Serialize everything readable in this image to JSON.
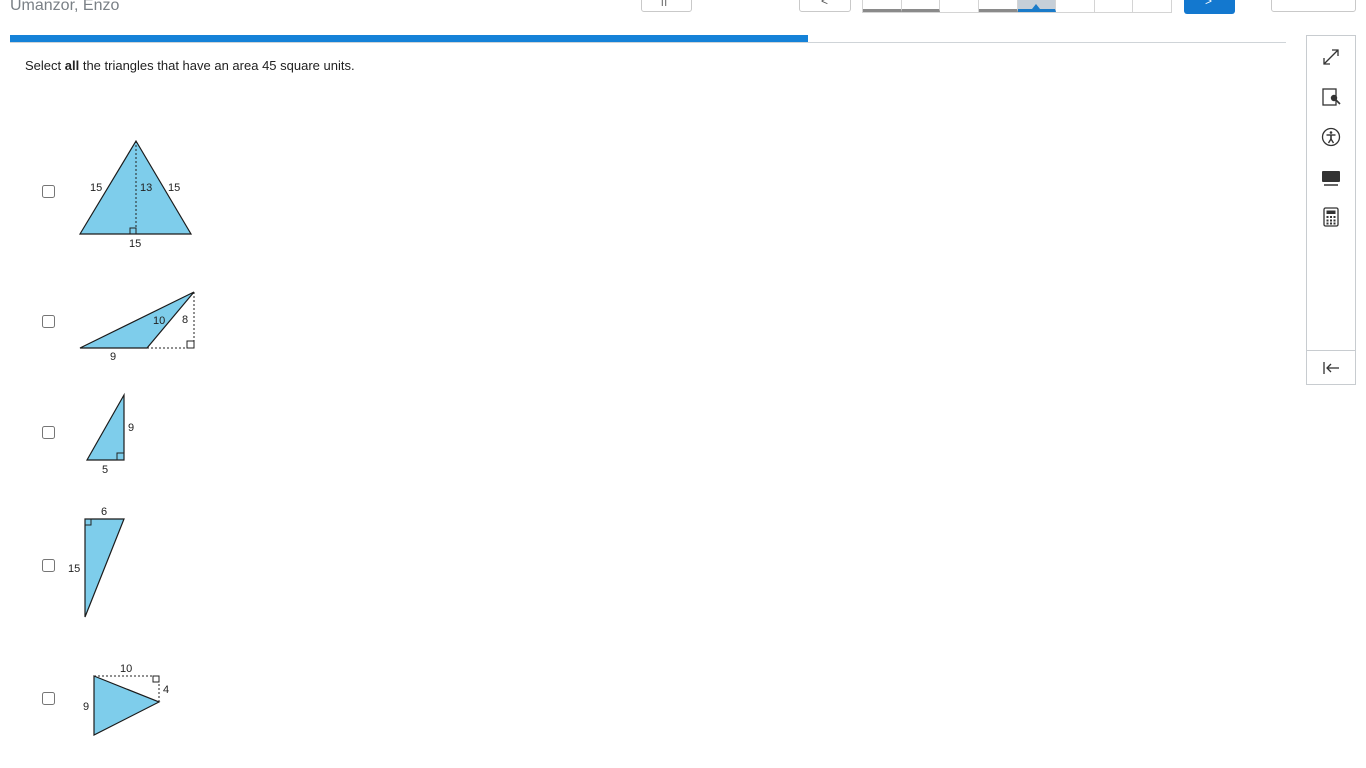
{
  "header": {
    "student_name": "Umanzor, Enzo",
    "pause_label": "II",
    "back_label": "<",
    "next_label": ">",
    "review_label": "",
    "nav_cells": [
      "answered",
      "answered",
      "empty",
      "answered",
      "current",
      "empty",
      "empty",
      "empty"
    ],
    "accent_color": "#1378cf"
  },
  "progress": {
    "fraction": 0.625
  },
  "question": {
    "prefix": "Select ",
    "emphasis": "all",
    "suffix": " the triangles that have an area 45 square units."
  },
  "options": [
    {
      "id": "a",
      "labels": [
        "15",
        "13",
        "15",
        "15"
      ]
    },
    {
      "id": "b",
      "labels": [
        "10",
        "8",
        "9"
      ]
    },
    {
      "id": "c",
      "labels": [
        "9",
        "5"
      ]
    },
    {
      "id": "d",
      "labels": [
        "6",
        "15"
      ]
    },
    {
      "id": "e",
      "labels": [
        "10",
        "4",
        "9"
      ]
    }
  ],
  "toolbar": {
    "icons": [
      "expand-icon",
      "line-reader-icon",
      "accessibility-icon",
      "masking-icon",
      "calculator-icon",
      "collapse-panel-icon"
    ]
  },
  "colors": {
    "triangle_fill": "#7ecdeb",
    "progress": "#1582d8"
  }
}
